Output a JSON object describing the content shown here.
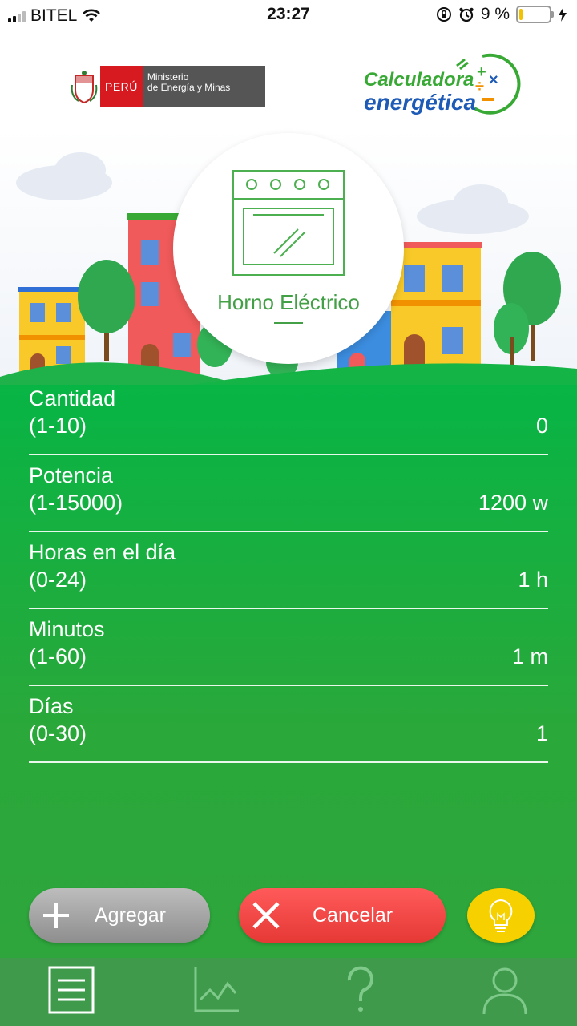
{
  "status": {
    "carrier": "BITEL",
    "time": "23:27",
    "battery_percent": "9 %"
  },
  "header": {
    "peru_label": "PERÚ",
    "ministry_line1": "Ministerio",
    "ministry_line2": "de Energía y Minas",
    "app_logo_line1": "Calculadora",
    "app_logo_line2": "energética"
  },
  "appliance": {
    "name": "Horno Eléctrico",
    "icon": "oven-icon"
  },
  "fields": [
    {
      "label": "Cantidad",
      "range": "(1-10)",
      "value": "0"
    },
    {
      "label": "Potencia",
      "range": "(1-15000)",
      "value": "1200 w"
    },
    {
      "label": "Horas en el día",
      "range": "(0-24)",
      "value": "1 h"
    },
    {
      "label": "Minutos",
      "range": "(1-60)",
      "value": "1 m"
    },
    {
      "label": "Días",
      "range": "(0-30)",
      "value": "1"
    }
  ],
  "actions": {
    "add_label": "Agregar",
    "cancel_label": "Cancelar",
    "tip_icon": "lightbulb-icon"
  },
  "tabs": [
    {
      "name": "list",
      "icon": "list-icon",
      "active": true
    },
    {
      "name": "chart",
      "icon": "chart-icon",
      "active": false
    },
    {
      "name": "help",
      "icon": "question-icon",
      "active": false
    },
    {
      "name": "profile",
      "icon": "user-icon",
      "active": false
    }
  ],
  "colors": {
    "green_panel": "#07b545",
    "cancel": "#e53935",
    "add": "#9e9e9e",
    "bulb": "#f7d000",
    "tabbar": "#3f9b4b"
  }
}
